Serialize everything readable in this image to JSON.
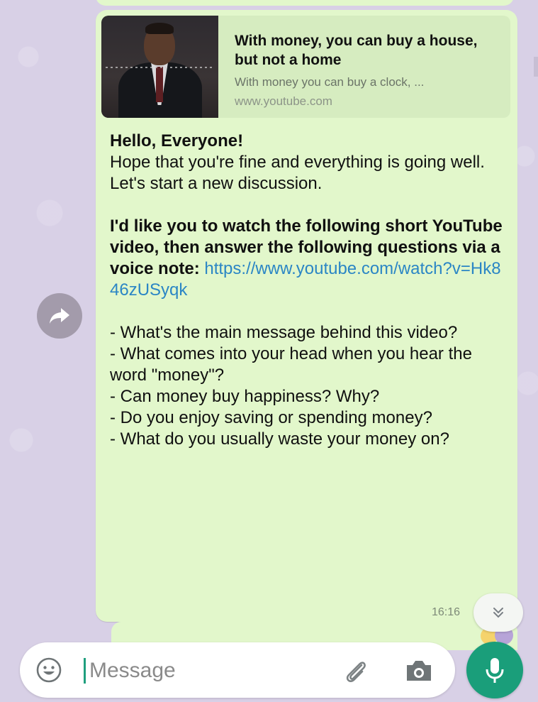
{
  "chat": {
    "link_preview": {
      "title": "With money, you can buy a house, but not a home",
      "description": "With money you can buy a clock, ...",
      "domain": "www.youtube.com"
    },
    "message": {
      "greeting": "Hello, Everyone!",
      "line1": "Hope that you're fine and everything is going well.",
      "line2": "Let's start a new discussion.",
      "instruction_bold": "I'd like you to watch the following short YouTube video, then answer the following questions via a voice note:",
      "url": "https://www.youtube.com/watch?v=Hk846zUSyqk",
      "questions": [
        "- What's the main message behind this video?",
        "- What comes into your head when you hear the word \"money\"?",
        "- Can money buy happiness?  Why?",
        "- Do you enjoy saving or spending money?",
        "- What do you usually waste your money on?"
      ],
      "time": "16:16"
    }
  },
  "composer": {
    "placeholder": "Message"
  },
  "colors": {
    "outgoing_bubble": "#e2f7cb",
    "wallpaper": "#d8d0e6",
    "link": "#2b86c5",
    "accent": "#1a9e7a"
  },
  "icons": {
    "forward": "forward-arrow-icon",
    "scroll_down": "double-chevron-down-icon",
    "emoji": "emoji-icon",
    "attach": "paperclip-icon",
    "camera": "camera-icon",
    "mic": "microphone-icon"
  }
}
